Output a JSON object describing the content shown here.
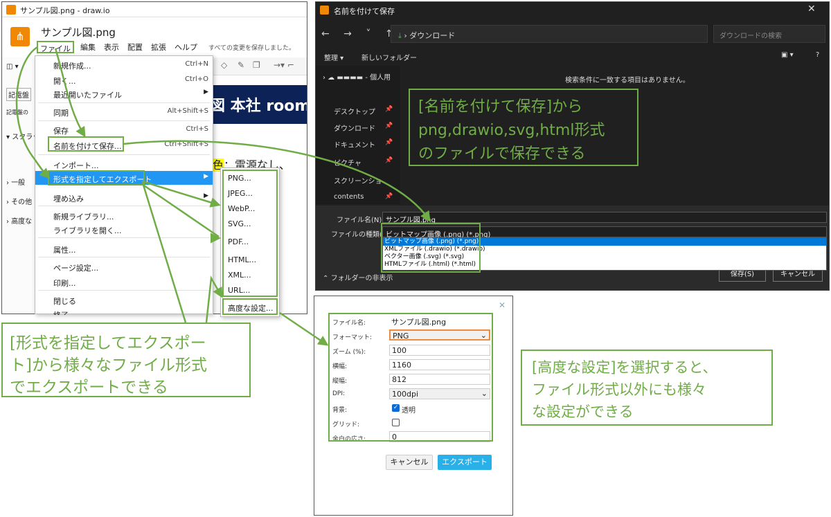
{
  "drawio": {
    "window_title": "サンプル図.png - draw.io",
    "doc_name": "サンプル図.png",
    "menu": [
      "ファイル",
      "編集",
      "表示",
      "配置",
      "拡張",
      "ヘルプ"
    ],
    "saved_status": "すべての変更を保存しました。",
    "left_panel": [
      "記電盤",
      "記電盤の",
      "スクラッ",
      "一般",
      "その他",
      "高度な"
    ],
    "canvas_banner": "図 本社 room",
    "canvas_text_hl": "色",
    "canvas_text_rest": "：電源なし、",
    "file_menu": {
      "new": {
        "label": "新規作成...",
        "shortcut": "Ctrl+N"
      },
      "open": {
        "label": "開く...",
        "shortcut": "Ctrl+O"
      },
      "recent": {
        "label": "最近開いたファイル"
      },
      "sync": {
        "label": "同期",
        "shortcut": "Alt+Shift+S"
      },
      "save": {
        "label": "保存",
        "shortcut": "Ctrl+S"
      },
      "save_as": {
        "label": "名前を付けて保存...",
        "shortcut": "Ctrl+Shift+S"
      },
      "import": {
        "label": "インポート..."
      },
      "export_as": {
        "label": "形式を指定してエクスポート"
      },
      "embed": {
        "label": "埋め込み"
      },
      "new_library": {
        "label": "新規ライブラリ..."
      },
      "open_library": {
        "label": "ライブラリを開く..."
      },
      "properties": {
        "label": "属性..."
      },
      "page_setup": {
        "label": "ページ設定..."
      },
      "print": {
        "label": "印刷..."
      },
      "close": {
        "label": "閉じる"
      },
      "exit": {
        "label": "終了"
      }
    },
    "export_submenu": [
      "PNG...",
      "JPEG...",
      "WebP...",
      "SVG...",
      "PDF...",
      "HTML...",
      "XML...",
      "URL...",
      "高度な設定..."
    ]
  },
  "saveas": {
    "title": "名前を付けて保存",
    "path": "ダウンロード",
    "search_placeholder": "ダウンロードの検索",
    "organize": "整理",
    "new_folder": "新しいフォルダー",
    "side_items": [
      "- 個人用",
      "デスクトップ",
      "ダウンロード",
      "ドキュメント",
      "ピクチャ",
      "スクリーンショット",
      "contents"
    ],
    "no_items": "検索条件に一致する項目はありません。",
    "filename_label": "ファイル名(N):",
    "filename_value": "サンプル図.png",
    "filetype_label": "ファイルの種類(T):",
    "filetype_value": "ビットマップ画像 (.png) (*.png)",
    "filetype_options": [
      "ビットマップ画像 (.png) (*.png)",
      "XMLファイル (.drawio) (*.drawio)",
      "ベクター画像 (.svg) (*.svg)",
      "HTMLファイル (.html) (*.html)"
    ],
    "hide_folders": "フォルダーの非表示",
    "save_button": "保存(S)",
    "cancel_button": "キャンセル"
  },
  "export_dialog": {
    "filename_label": "ファイル名:",
    "filename_value": "サンプル図.png",
    "format_label": "フォーマット:",
    "format_value": "PNG",
    "zoom_label": "ズーム (%):",
    "zoom_value": "100",
    "width_label": "横幅:",
    "width_value": "1160",
    "height_label": "縦幅:",
    "height_value": "812",
    "dpi_label": "DPI:",
    "dpi_value": "100dpi",
    "background_label": "背景:",
    "transparent_label": "透明",
    "transparent_checked": true,
    "grid_label": "グリッド:",
    "grid_checked": false,
    "border_label": "余白の広さ:",
    "border_value": "0",
    "cancel_button": "キャンセル",
    "export_button": "エクスポート"
  },
  "callouts": {
    "saveas": [
      "[名前を付けて保存]から",
      "png,drawio,svg,html形式",
      "のファイルで保存できる"
    ],
    "export": [
      "[形式を指定してエクスポー",
      "ト]から様々なファイル形式",
      "でエクスポートできる"
    ],
    "advanced": [
      "[高度な設定]を選択すると、",
      "ファイル形式以外にも様々",
      "な設定ができる"
    ]
  },
  "colors": {
    "callout_green": "#70ad47",
    "drawio_orange": "#f08705",
    "highlight_blue": "#2196f3",
    "export_button": "#2ab0e8"
  }
}
